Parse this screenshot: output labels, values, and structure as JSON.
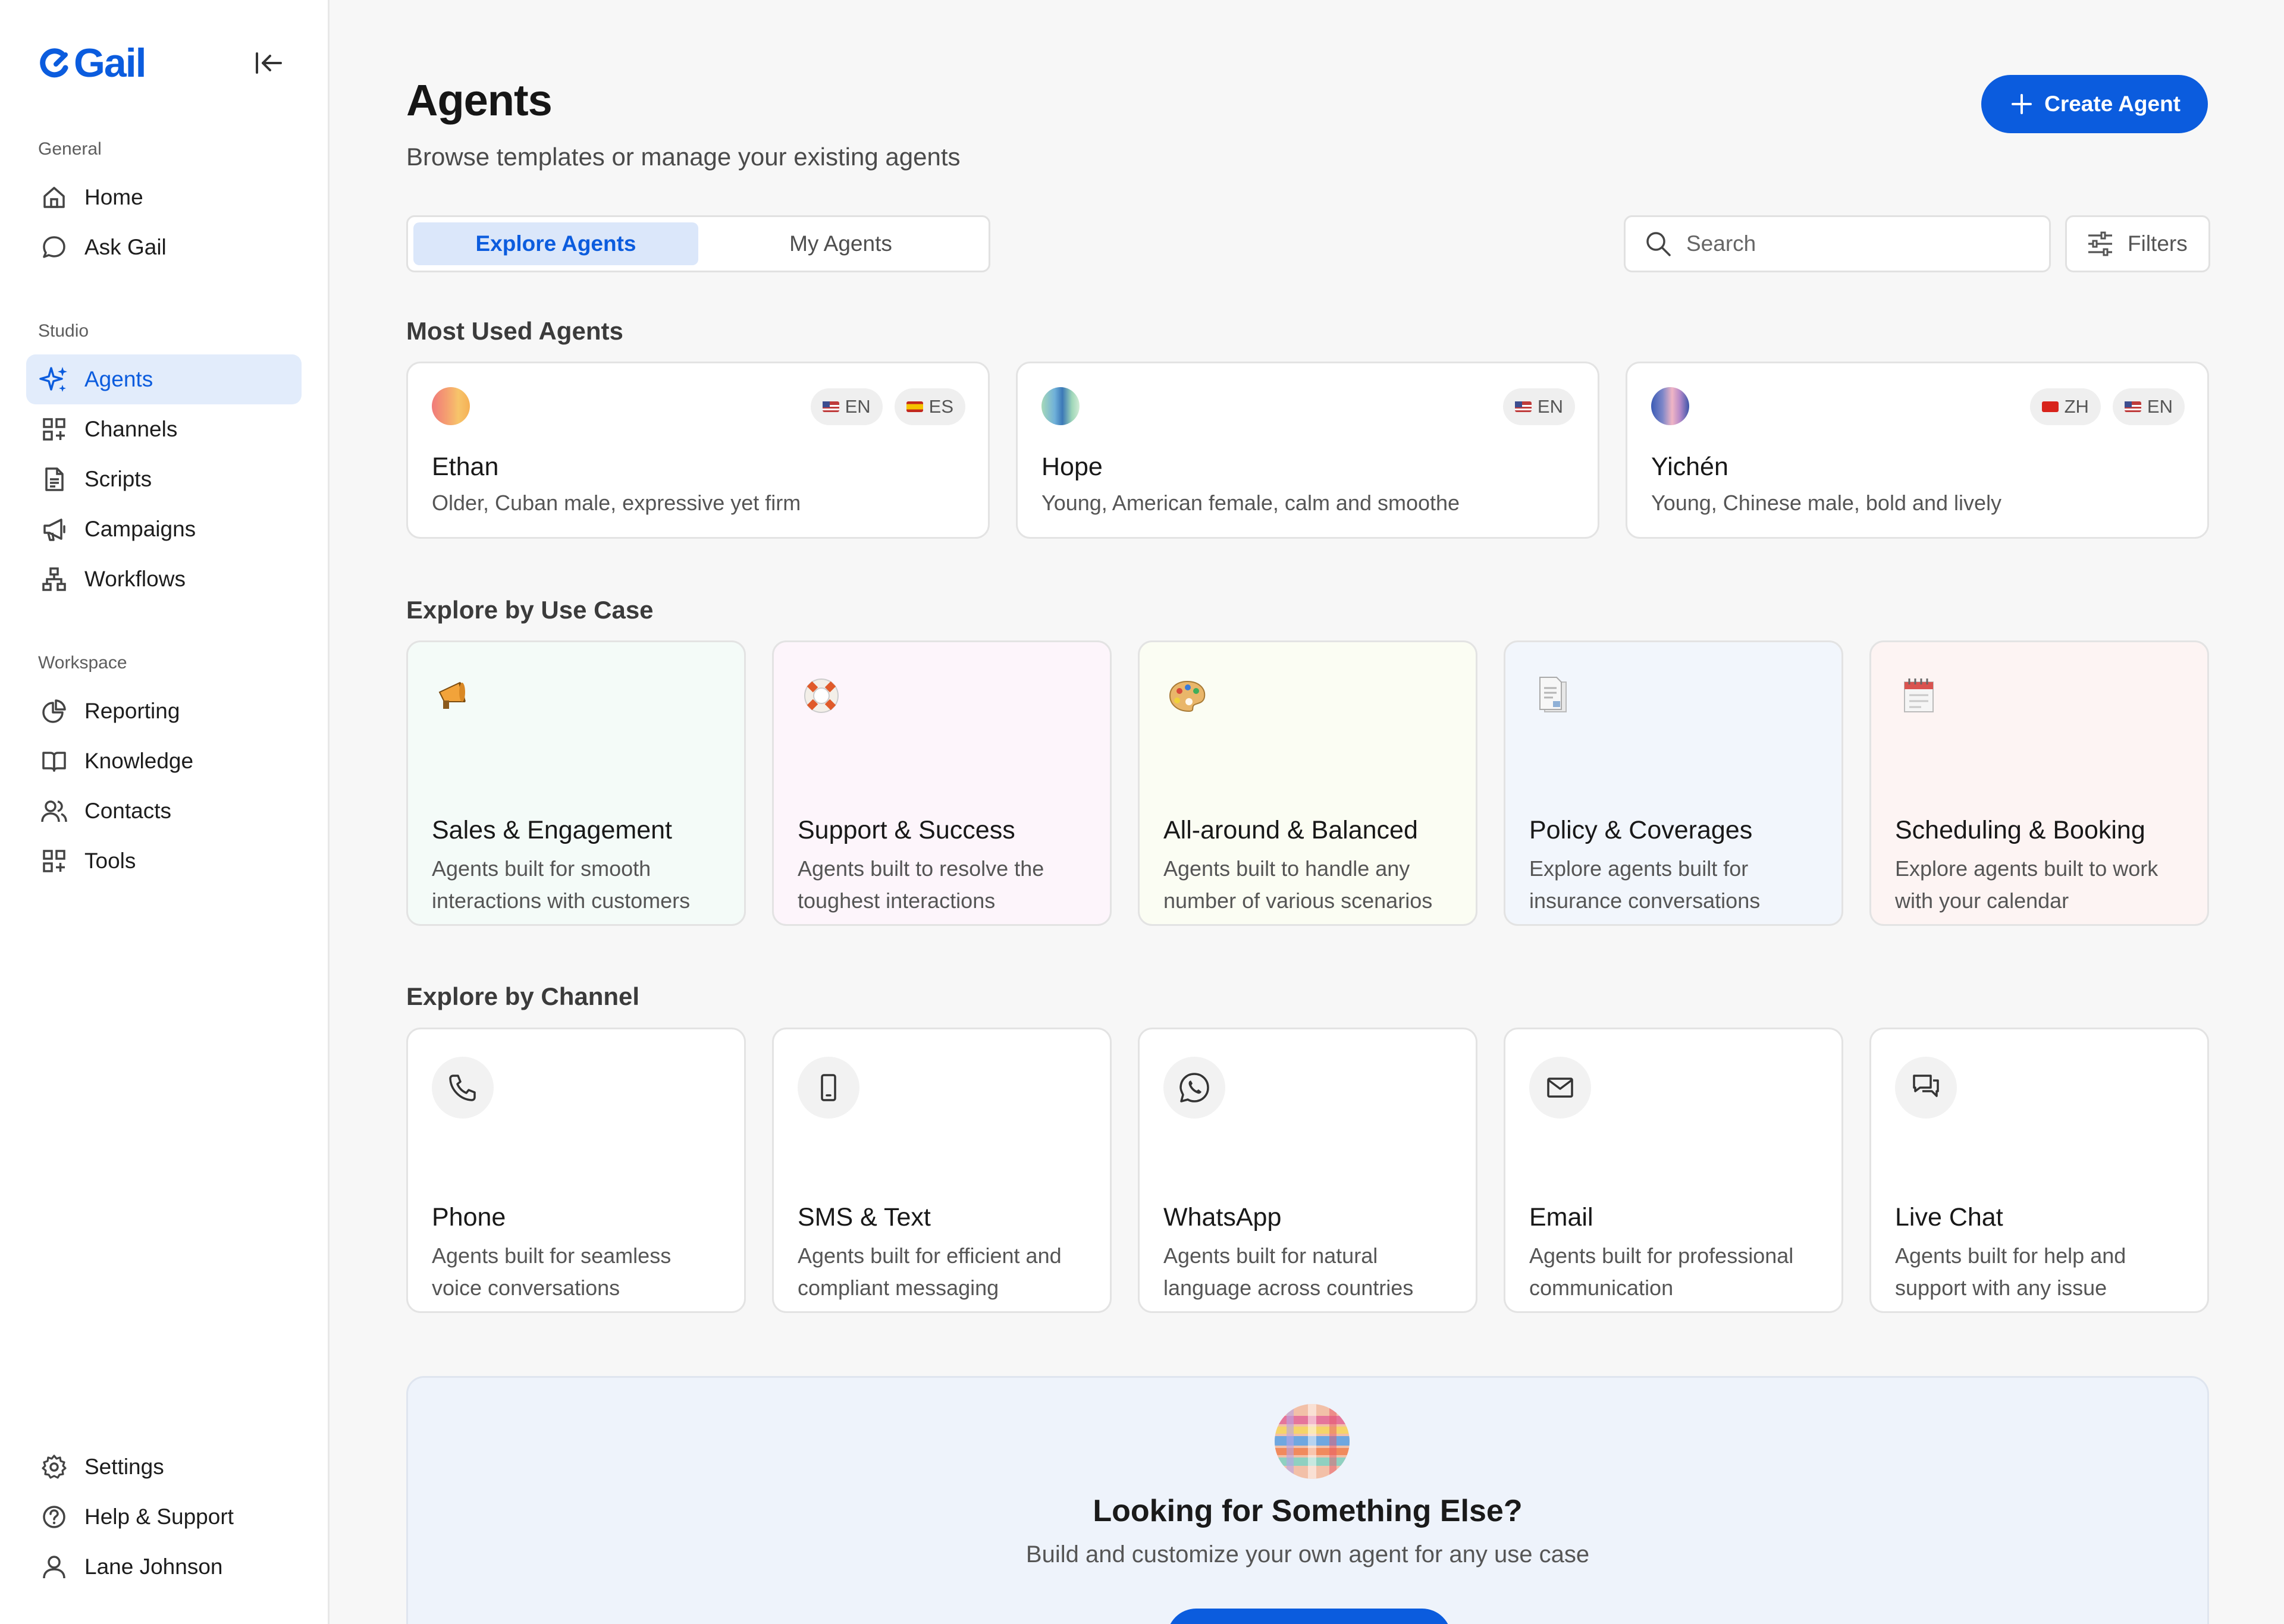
{
  "brand": {
    "name": "Gail",
    "color": "#0b5cde"
  },
  "sidebar": {
    "sections": [
      {
        "title": "General",
        "items": [
          {
            "label": "Home",
            "icon": "home-icon"
          },
          {
            "label": "Ask Gail",
            "icon": "chat-bubble-icon"
          }
        ]
      },
      {
        "title": "Studio",
        "items": [
          {
            "label": "Agents",
            "icon": "sparkle-icon",
            "active": true
          },
          {
            "label": "Channels",
            "icon": "grid-plus-icon"
          },
          {
            "label": "Scripts",
            "icon": "document-icon"
          },
          {
            "label": "Campaigns",
            "icon": "megaphone-icon"
          },
          {
            "label": "Workflows",
            "icon": "hierarchy-icon"
          }
        ]
      },
      {
        "title": "Workspace",
        "items": [
          {
            "label": "Reporting",
            "icon": "pie-chart-icon"
          },
          {
            "label": "Knowledge",
            "icon": "book-icon"
          },
          {
            "label": "Contacts",
            "icon": "users-icon"
          },
          {
            "label": "Tools",
            "icon": "grid-plus-icon"
          }
        ]
      }
    ],
    "bottom": [
      {
        "label": "Settings",
        "icon": "gear-icon"
      },
      {
        "label": "Help & Support",
        "icon": "help-circle-icon"
      },
      {
        "label": "Lane Johnson",
        "icon": "user-icon"
      }
    ]
  },
  "header": {
    "title": "Agents",
    "subtitle": "Browse templates or manage your existing agents",
    "create_label": "Create Agent"
  },
  "tabs": [
    {
      "label": "Explore Agents",
      "active": true
    },
    {
      "label": "My Agents",
      "active": false
    }
  ],
  "search": {
    "placeholder": "Search"
  },
  "filters_label": "Filters",
  "most_used": {
    "title": "Most Used Agents",
    "agents": [
      {
        "name": "Ethan",
        "description": "Older, Cuban male, expressive yet firm",
        "languages": [
          {
            "code": "EN",
            "flag": "us"
          },
          {
            "code": "ES",
            "flag": "es"
          }
        ]
      },
      {
        "name": "Hope",
        "description": "Young, American female, calm and smoothe",
        "languages": [
          {
            "code": "EN",
            "flag": "us"
          }
        ]
      },
      {
        "name": "Yichén",
        "description": "Young, Chinese male, bold and lively",
        "languages": [
          {
            "code": "ZH",
            "flag": "cn"
          },
          {
            "code": "EN",
            "flag": "us"
          }
        ]
      }
    ]
  },
  "use_cases": {
    "title": "Explore by Use Case",
    "items": [
      {
        "title": "Sales & Engagement",
        "description": "Agents built for smooth interactions with customers",
        "icon": "megaphone-icon",
        "tint": "#f4fbf8"
      },
      {
        "title": "Support & Success",
        "description": "Agents built to resolve the toughest interactions",
        "icon": "lifebuoy-icon",
        "tint": "#fdf5fb"
      },
      {
        "title": "All-around & Balanced",
        "description": "Agents built to handle any number of various scenarios",
        "icon": "palette-icon",
        "tint": "#fbfdf3"
      },
      {
        "title": "Policy & Coverages",
        "description": "Explore agents built for insurance conversations",
        "icon": "documents-icon",
        "tint": "#f2f6fc"
      },
      {
        "title": "Scheduling & Booking",
        "description": "Explore agents built to work with your calendar",
        "icon": "calendar-icon",
        "tint": "#fdf4f3"
      }
    ]
  },
  "channels": {
    "title": "Explore by Channel",
    "items": [
      {
        "title": "Phone",
        "description": "Agents built for seamless voice conversations",
        "icon": "phone-icon"
      },
      {
        "title": "SMS & Text",
        "description": "Agents built for efficient and compliant messaging",
        "icon": "mobile-icon"
      },
      {
        "title": "WhatsApp",
        "description": "Agents built for natural language across countries",
        "icon": "whatsapp-icon"
      },
      {
        "title": "Email",
        "description": "Agents built for professional communication",
        "icon": "mail-icon"
      },
      {
        "title": "Live Chat",
        "description": "Agents built for help and support with any issue",
        "icon": "chat-bubbles-icon"
      }
    ]
  },
  "banner": {
    "title": "Looking for Something Else?",
    "subtitle": "Build and customize your own agent for any use case"
  }
}
